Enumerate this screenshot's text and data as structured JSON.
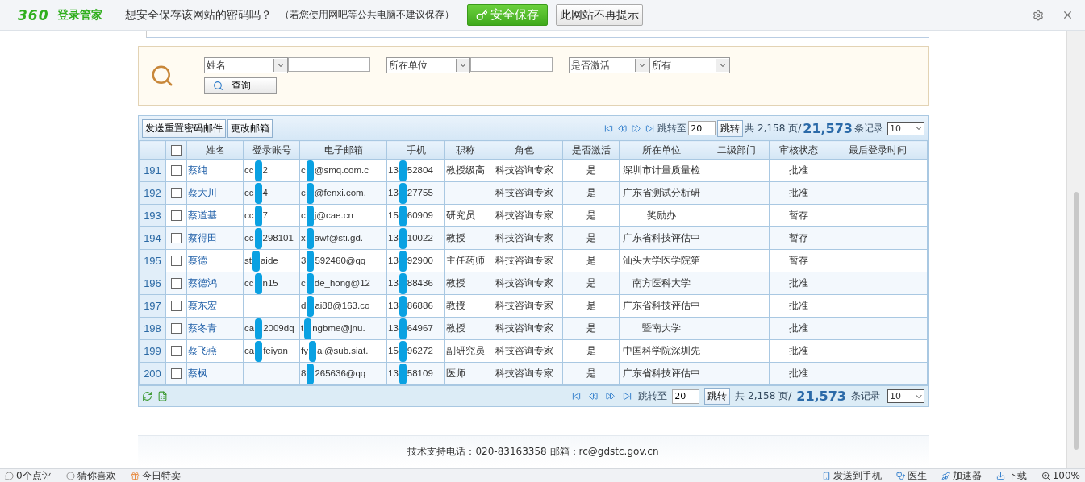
{
  "password_bar": {
    "logo_number": "360",
    "logo_text": "登录管家",
    "question": "想安全保存该网站的密码吗？",
    "hint": "（若您使用网吧等公共电脑不建议保存）",
    "save_button": "安全保存",
    "never_button": "此网站不再提示"
  },
  "search": {
    "filters": [
      {
        "field": "姓名"
      },
      {
        "field": "所在单位"
      },
      {
        "field": "是否激活",
        "value": "所有",
        "kind": "select"
      }
    ],
    "button": "查询"
  },
  "toolbar": {
    "buttons": [
      "发送重置密码邮件",
      "更改邮箱"
    ]
  },
  "pager_top": {
    "jump_label": "跳转至",
    "page": "20",
    "jump_button": "跳转",
    "pages_text": "共 2,158 页/",
    "total": "21,573",
    "records_label": "条记录",
    "page_size": "10"
  },
  "table": {
    "select_all_checked": false,
    "columns": [
      "姓名",
      "登录账号",
      "电子邮箱",
      "手机",
      "职称",
      "角色",
      "是否激活",
      "所在单位",
      "二级部门",
      "审核状态",
      "最后登录时间"
    ],
    "rows": [
      {
        "no": "191",
        "checked": false,
        "name": "蔡纯",
        "account": [
          "cc",
          "2"
        ],
        "email": [
          "c",
          "@smq.com.c"
        ],
        "phone": [
          "13",
          "52804"
        ],
        "title": "教授级高",
        "role": "科技咨询专家",
        "active": "是",
        "unit": "深圳市计量质量检",
        "status": "批准"
      },
      {
        "no": "192",
        "checked": false,
        "name": "蔡大川",
        "account": [
          "cc",
          "4"
        ],
        "email": [
          "c",
          "@fenxi.com."
        ],
        "phone": [
          "13",
          "27755"
        ],
        "title": "",
        "role": "科技咨询专家",
        "active": "是",
        "unit": "广东省测试分析研",
        "status": "批准"
      },
      {
        "no": "193",
        "checked": false,
        "name": "蔡道基",
        "account": [
          "cc",
          "7"
        ],
        "email": [
          "c",
          "j@cae.cn"
        ],
        "phone": [
          "15",
          "60909"
        ],
        "title": "研究员",
        "role": "科技咨询专家",
        "active": "是",
        "unit": "奖励办",
        "status": "暂存"
      },
      {
        "no": "194",
        "checked": false,
        "name": "蔡得田",
        "account": [
          "cc",
          "298101"
        ],
        "email": [
          "x",
          "awf@sti.gd."
        ],
        "phone": [
          "13",
          "10022"
        ],
        "title": "教授",
        "role": "科技咨询专家",
        "active": "是",
        "unit": "广东省科技评估中",
        "status": "暂存"
      },
      {
        "no": "195",
        "checked": false,
        "name": "蔡德",
        "account": [
          "st",
          "aide"
        ],
        "email": [
          "3",
          "592460@qq"
        ],
        "phone": [
          "13",
          "92900"
        ],
        "title": "主任药师",
        "role": "科技咨询专家",
        "active": "是",
        "unit": "汕头大学医学院第",
        "status": "暂存"
      },
      {
        "no": "196",
        "checked": false,
        "name": "蔡德鸿",
        "account": [
          "cc",
          "n15"
        ],
        "email": [
          "c",
          "de_hong@12"
        ],
        "phone": [
          "13",
          "88436"
        ],
        "title": "教授",
        "role": "科技咨询专家",
        "active": "是",
        "unit": "南方医科大学",
        "status": "批准"
      },
      {
        "no": "197",
        "checked": false,
        "name": "蔡东宏",
        "account": [],
        "email": [
          "d",
          "ai88@163.co"
        ],
        "phone": [
          "13",
          "86886"
        ],
        "title": "教授",
        "role": "科技咨询专家",
        "active": "是",
        "unit": "广东省科技评估中",
        "status": "批准"
      },
      {
        "no": "198",
        "checked": false,
        "name": "蔡冬青",
        "account": [
          "ca",
          "2009dq"
        ],
        "email": [
          "t",
          "ngbme@jnu."
        ],
        "phone": [
          "13",
          "64967"
        ],
        "title": "教授",
        "role": "科技咨询专家",
        "active": "是",
        "unit": "暨南大学",
        "status": "批准"
      },
      {
        "no": "199",
        "checked": false,
        "name": "蔡飞燕",
        "account": [
          "ca",
          "feiyan"
        ],
        "email": [
          "fy",
          "ai@sub.siat."
        ],
        "phone": [
          "15",
          "96272"
        ],
        "title": "副研究员",
        "role": "科技咨询专家",
        "active": "是",
        "unit": "中国科学院深圳先",
        "status": "批准"
      },
      {
        "no": "200",
        "checked": false,
        "name": "蔡枫",
        "account": [],
        "email": [
          "8",
          "265636@qq"
        ],
        "phone": [
          "13",
          "58109"
        ],
        "title": "医师",
        "role": "科技咨询专家",
        "active": "是",
        "unit": "广东省科技评估中",
        "status": "批准"
      }
    ]
  },
  "pager_bottom": {
    "jump_label": "跳转至",
    "page": "20",
    "jump_button": "跳转",
    "pages_text": "共 2,158 页/",
    "total": "21,573",
    "records_label": "条记录",
    "page_size": "10"
  },
  "footer": {
    "text": "技术支持电话：020-83163358  邮箱：rc@gdstc.gov.cn"
  },
  "status_bar": {
    "left": [
      "0个点评",
      "猜你喜欢",
      "今日特卖"
    ],
    "right": [
      "发送到手机",
      "医生",
      "加速器",
      "下载"
    ],
    "zoom": "100%"
  }
}
